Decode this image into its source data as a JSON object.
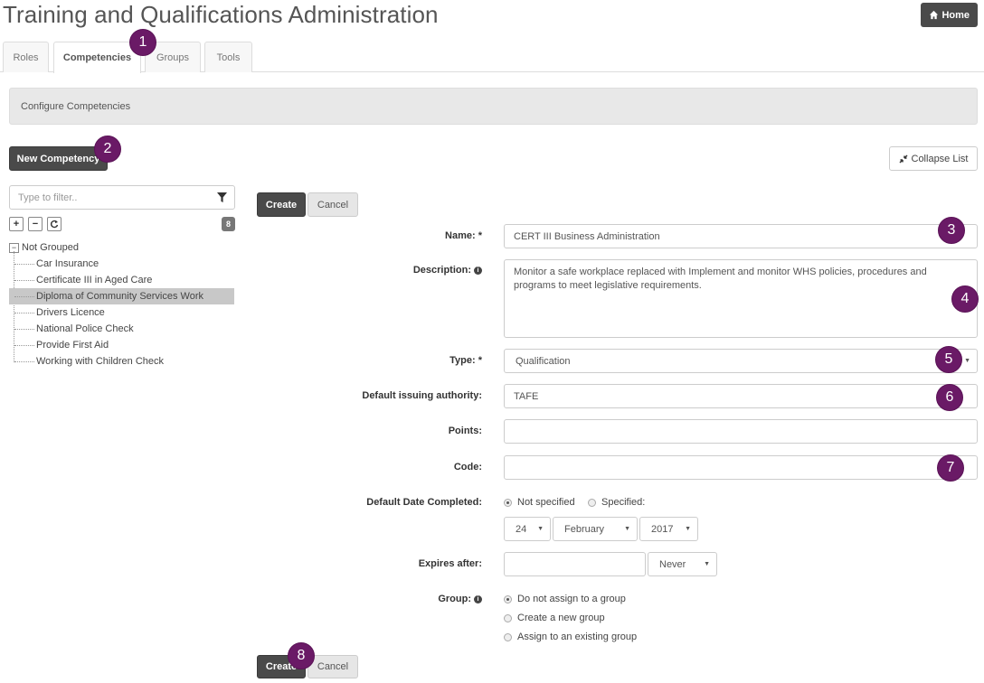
{
  "header": {
    "title": "Training and Qualifications Administration",
    "home_label": "Home"
  },
  "tabs": [
    "Roles",
    "Competencies",
    "Groups",
    "Tools"
  ],
  "active_tab": "Competencies",
  "panel": {
    "title": "Configure Competencies"
  },
  "toolbar": {
    "new_label": "New Competency",
    "collapse_label": "Collapse List"
  },
  "sidebar": {
    "filter_placeholder": "Type to filter..",
    "count": "8",
    "group_name": "Not Grouped",
    "items": [
      "Car Insurance",
      "Certificate III in Aged Care",
      "Diploma of Community Services Work",
      "Drivers Licence",
      "National Police Check",
      "Provide First Aid",
      "Working with Children Check"
    ],
    "selected_item": "Diploma of Community Services Work"
  },
  "form": {
    "create_label": "Create",
    "cancel_label": "Cancel",
    "name_label": "Name: *",
    "name_value": "CERT III Business Administration",
    "description_label": "Description:",
    "description_value": "Monitor a safe workplace replaced with Implement and monitor WHS policies, procedures and programs to meet legislative requirements.",
    "type_label": "Type: *",
    "type_value": "Qualification",
    "authority_label": "Default issuing authority:",
    "authority_value": "TAFE",
    "points_label": "Points:",
    "points_value": "",
    "code_label": "Code:",
    "code_value": "",
    "date_label": "Default Date Completed:",
    "date_not_specified": "Not specified",
    "date_specified": "Specified:",
    "date_day": "24",
    "date_month": "February",
    "date_year": "2017",
    "expires_label": "Expires after:",
    "expires_value": "",
    "expires_unit": "Never",
    "group_label": "Group:",
    "group_options": [
      "Do not assign to a group",
      "Create a new group",
      "Assign to an existing group"
    ]
  },
  "markers": [
    "1",
    "2",
    "3",
    "4",
    "5",
    "6",
    "7",
    "8"
  ],
  "colors": {
    "marker": "#6a1a66",
    "dark_button": "#4a4a4a",
    "selected_row": "#c8c8c8"
  }
}
